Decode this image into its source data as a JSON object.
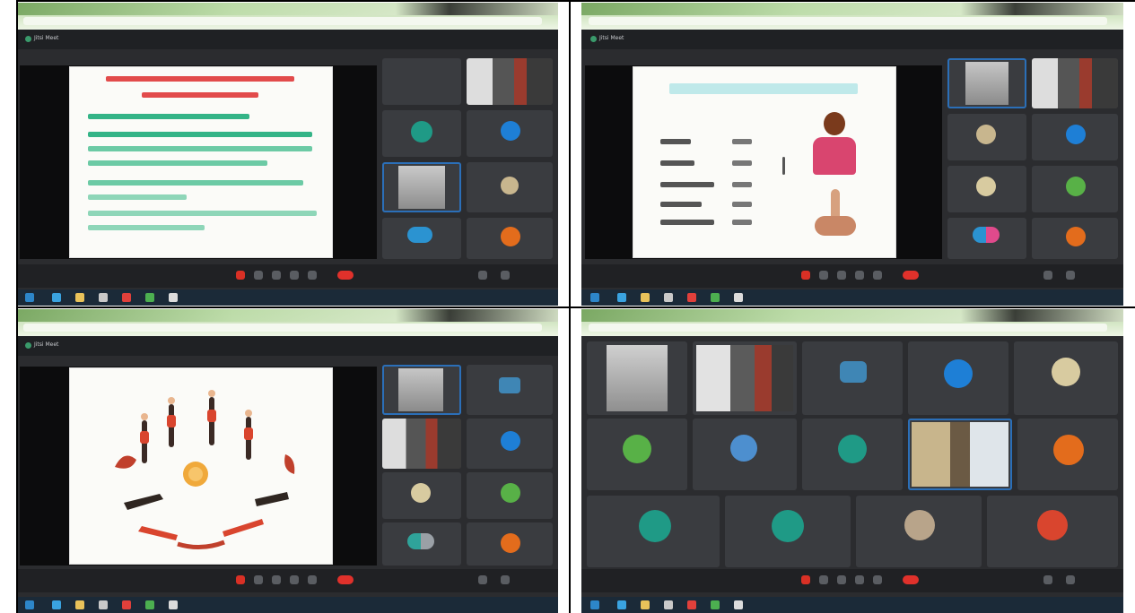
{
  "panels": [
    {
      "id": "top-left",
      "meeting_title": "Jitsi Meet",
      "controls_label": "",
      "slide": {
        "type": "text",
        "title": "",
        "lines": []
      },
      "tiles": []
    },
    {
      "id": "top-right",
      "meeting_title": "Jitsi Meet",
      "controls_label": "",
      "slide": {
        "type": "pose-illustration",
        "title": "",
        "lines": []
      },
      "tiles": []
    },
    {
      "id": "bottom-left",
      "meeting_title": "Jitsi Meet",
      "controls_label": "",
      "slide": {
        "type": "sun-salutation-circle",
        "title": "",
        "lines": []
      },
      "tiles": []
    },
    {
      "id": "bottom-right",
      "meeting_title": "Jitsi Meet",
      "controls_label": "",
      "view": "tile-gallery",
      "tiles": []
    }
  ],
  "colors": {
    "app_background": "#2b2c2f",
    "browser_green": "#b9d7a3",
    "end_call_red": "#e0312b",
    "active_speaker_blue": "#2b6fb8",
    "avatar_teal": "#1f9a86",
    "avatar_blue": "#1e7fd6",
    "avatar_green": "#58b147",
    "avatar_orange": "#e36c1c"
  },
  "icons": [
    "camera-icon",
    "microphone-icon",
    "screen-share-icon",
    "chat-icon",
    "participants-icon",
    "more-icon",
    "hangup-icon",
    "tile-view-icon"
  ]
}
